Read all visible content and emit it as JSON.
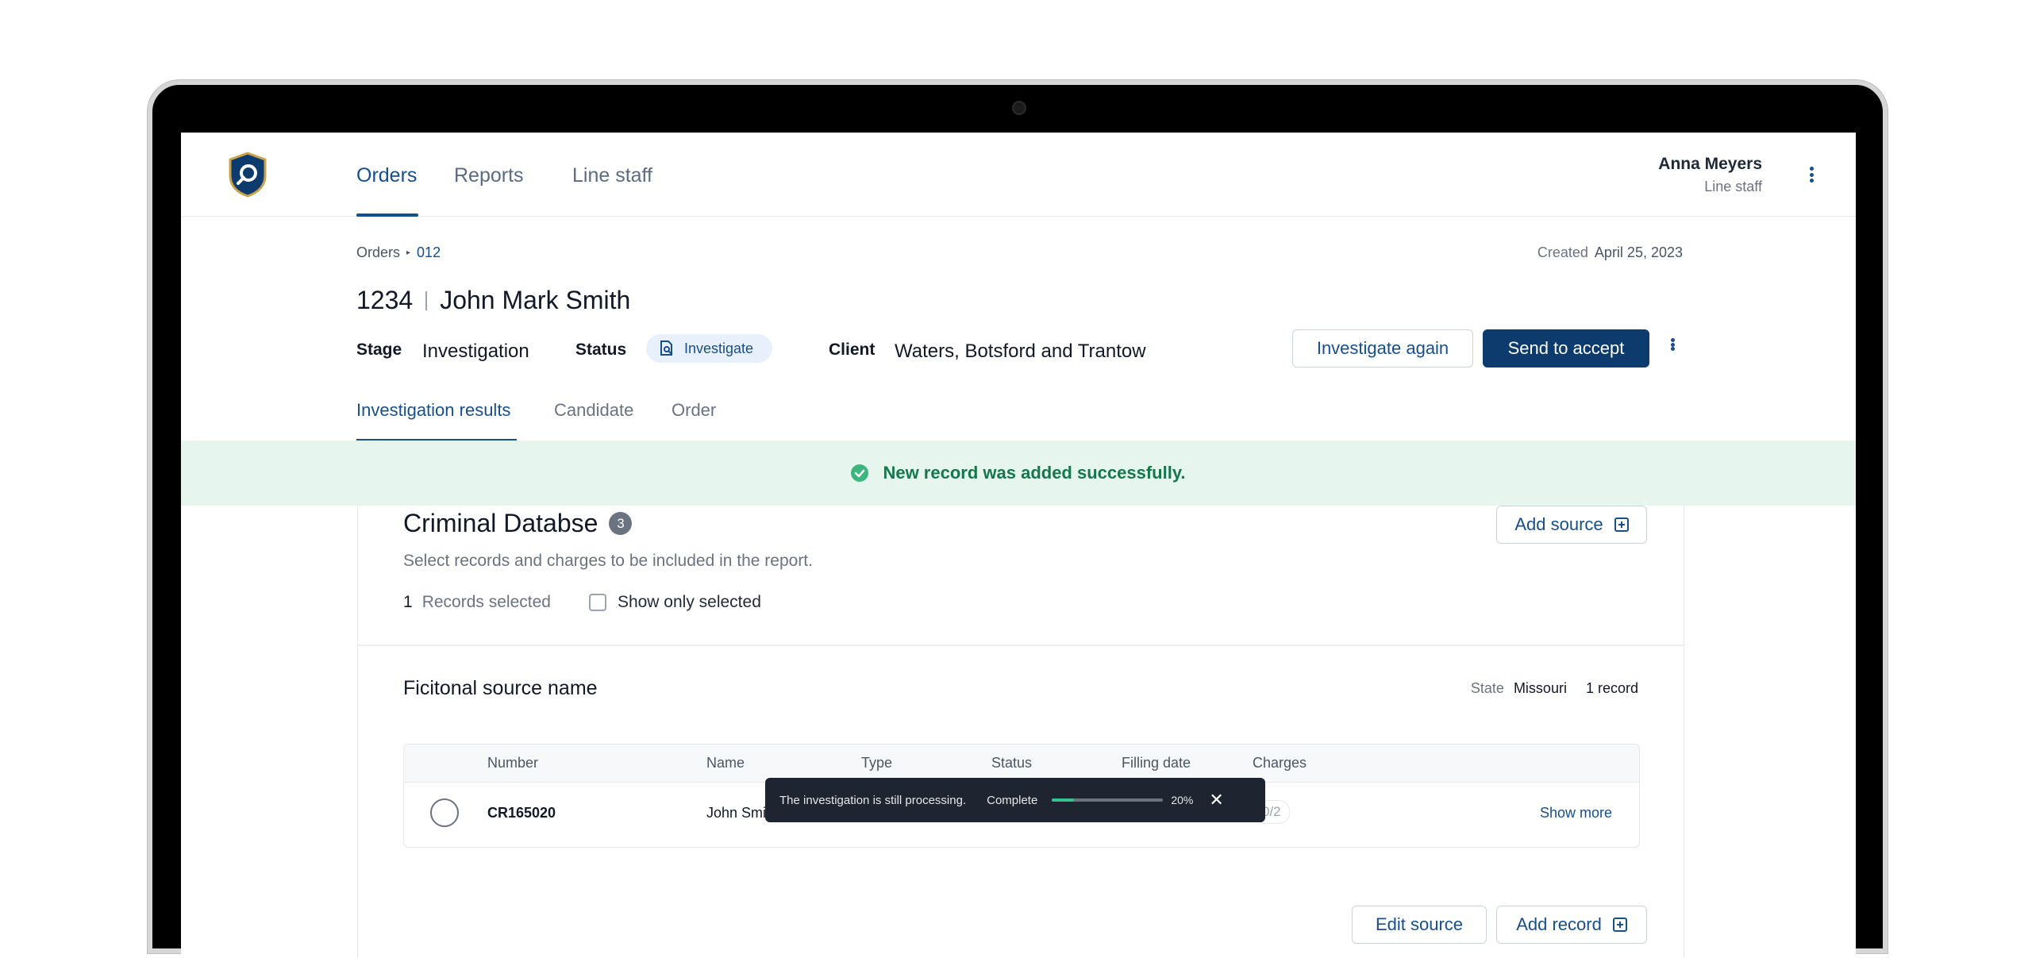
{
  "nav": {
    "items": [
      "Orders",
      "Reports",
      "Line staff"
    ],
    "active": "Orders"
  },
  "user": {
    "name": "Anna Meyers",
    "role": "Line staff"
  },
  "breadcrumb": {
    "root": "Orders",
    "current": "012"
  },
  "created": {
    "label": "Created",
    "date": "April 25, 2023"
  },
  "order": {
    "number": "1234",
    "name": "John Mark Smith",
    "stage_label": "Stage",
    "stage_value": "Investigation",
    "status_label": "Status",
    "status_value": "Investigate",
    "client_label": "Client",
    "client_value": "Waters, Botsford and Trantow"
  },
  "actions": {
    "investigate_again": "Investigate again",
    "send_to_accept": "Send to accept"
  },
  "tabs": [
    "Investigation results",
    "Candidate",
    "Order"
  ],
  "banner": {
    "message": "New record was added successfully."
  },
  "section": {
    "title": "Criminal Databse",
    "count": "3",
    "add_source": "Add source",
    "description": "Select records and charges to be included in the report.",
    "selected_count": "1",
    "selected_label": "Records selected",
    "show_only_selected": "Show only selected"
  },
  "source": {
    "name": "Ficitonal source name",
    "state_label": "State",
    "state_value": "Missouri",
    "record_count": "1 record",
    "columns": [
      "Number",
      "Name",
      "Type",
      "Status",
      "Filling date",
      "Charges"
    ],
    "rows": [
      {
        "number": "CR165020",
        "name": "John Smi",
        "charges": "0/2",
        "action": "Show more"
      }
    ],
    "edit_source": "Edit source",
    "add_record": "Add record"
  },
  "toast": {
    "message": "The investigation is still processing.",
    "label": "Complete",
    "progress": 0.2,
    "percent": "20%"
  },
  "colors": {
    "brand": "#174e8c",
    "primary_button": "#0d3b6e",
    "success_bg": "#e7f5ef",
    "success_text": "#16774d",
    "toast_bg": "#1f2530",
    "progress": "#34c38f"
  }
}
